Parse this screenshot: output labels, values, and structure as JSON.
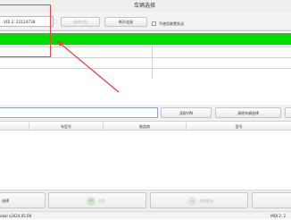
{
  "window": {
    "title": "车辆选择"
  },
  "toolbar": {
    "vci_field_value": "VDI 2: 22124738",
    "select_vehicle_button": "选择车型",
    "open_connection_button": "断开连接",
    "checkbox_label": "不使用装置发送"
  },
  "mid": {
    "read_vin_button": "读取VIN",
    "clear_vehicle_button": "清除车辆选择"
  },
  "table": {
    "columns": [
      "",
      "车型号",
      "制造商",
      "型号"
    ]
  },
  "bottom": {
    "left_button": "选择",
    "middle_button": "文件",
    "right_button": "车辆登录"
  },
  "status": {
    "left_text": "obal v2024.05.08",
    "right_text": "MDI 2: 2"
  },
  "colors": {
    "highlight_row": "#00dc00",
    "annotation": "#e54545",
    "input_focus_border": "#87a8c8"
  }
}
